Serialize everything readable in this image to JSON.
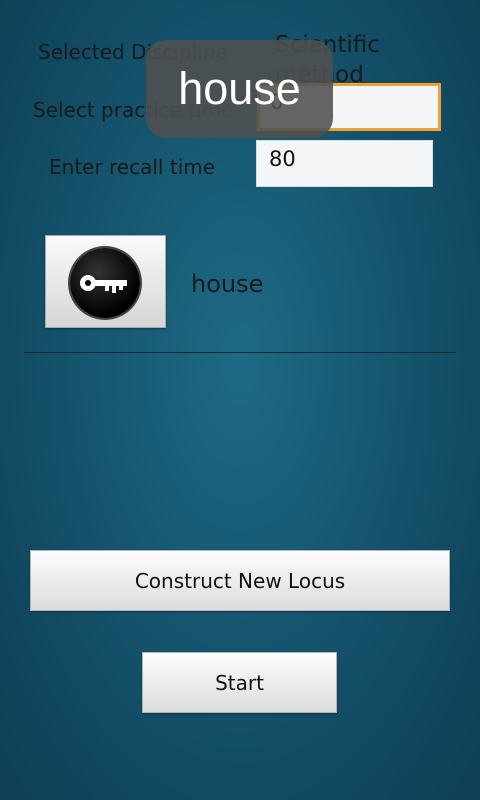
{
  "form": {
    "discipline_label": "Selected Discipline",
    "discipline_value": "Scientific method",
    "practice_label": "Select practice time",
    "practice_value": "0",
    "recall_label": "Enter recall time",
    "recall_value": "80"
  },
  "locus": {
    "icon": "key-icon",
    "name": "house"
  },
  "buttons": {
    "construct_label": "Construct New Locus",
    "start_label": "Start"
  },
  "toast": {
    "text": "house"
  },
  "colors": {
    "focus_border": "#f0a030",
    "background": "#175a74"
  }
}
